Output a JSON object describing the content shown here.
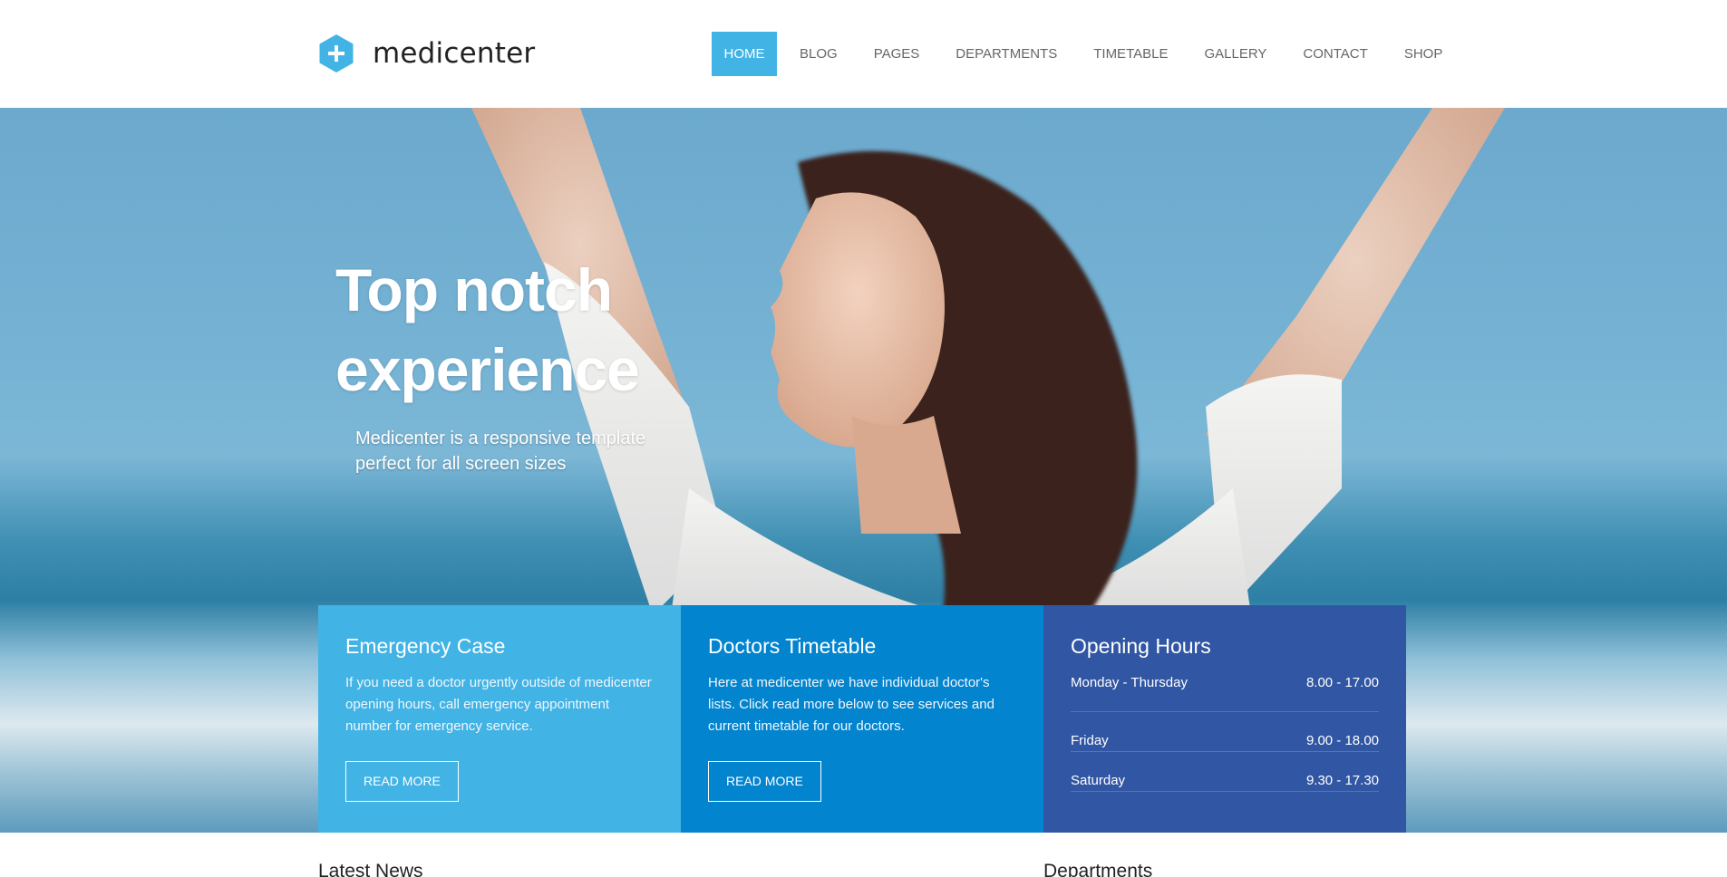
{
  "brand": {
    "name": "medicenter",
    "accent": "#42b3e5"
  },
  "nav": {
    "items": [
      {
        "label": "HOME",
        "active": true
      },
      {
        "label": "BLOG",
        "active": false
      },
      {
        "label": "PAGES",
        "active": false
      },
      {
        "label": "DEPARTMENTS",
        "active": false
      },
      {
        "label": "TIMETABLE",
        "active": false
      },
      {
        "label": "GALLERY",
        "active": false
      },
      {
        "label": "CONTACT",
        "active": false
      },
      {
        "label": "SHOP",
        "active": false
      }
    ]
  },
  "hero": {
    "title_line1": "Top notch",
    "title_line2": "experience",
    "subtitle_line1": "Medicenter is a responsive template",
    "subtitle_line2": "perfect for all screen sizes"
  },
  "boxes": {
    "emergency": {
      "title": "Emergency Case",
      "text": "If you need a doctor urgently outside of medicenter opening hours, call emergency appointment number for emergency service.",
      "button": "READ MORE",
      "color": "#42b3e5"
    },
    "timetable": {
      "title": "Doctors Timetable",
      "text": "Here at medicenter we have individual doctor's lists. Click read more below to see services and current timetable for our doctors.",
      "button": "READ MORE",
      "color": "#0384ce"
    },
    "hours": {
      "title": "Opening Hours",
      "color": "#3156a3",
      "rows": [
        {
          "day": "Monday - Thursday",
          "time": "8.00 - 17.00"
        },
        {
          "day": "Friday",
          "time": "9.00 - 18.00"
        },
        {
          "day": "Saturday",
          "time": "9.30 - 17.30"
        }
      ]
    }
  },
  "sections": {
    "latest_news": "Latest News",
    "departments": "Departments"
  }
}
